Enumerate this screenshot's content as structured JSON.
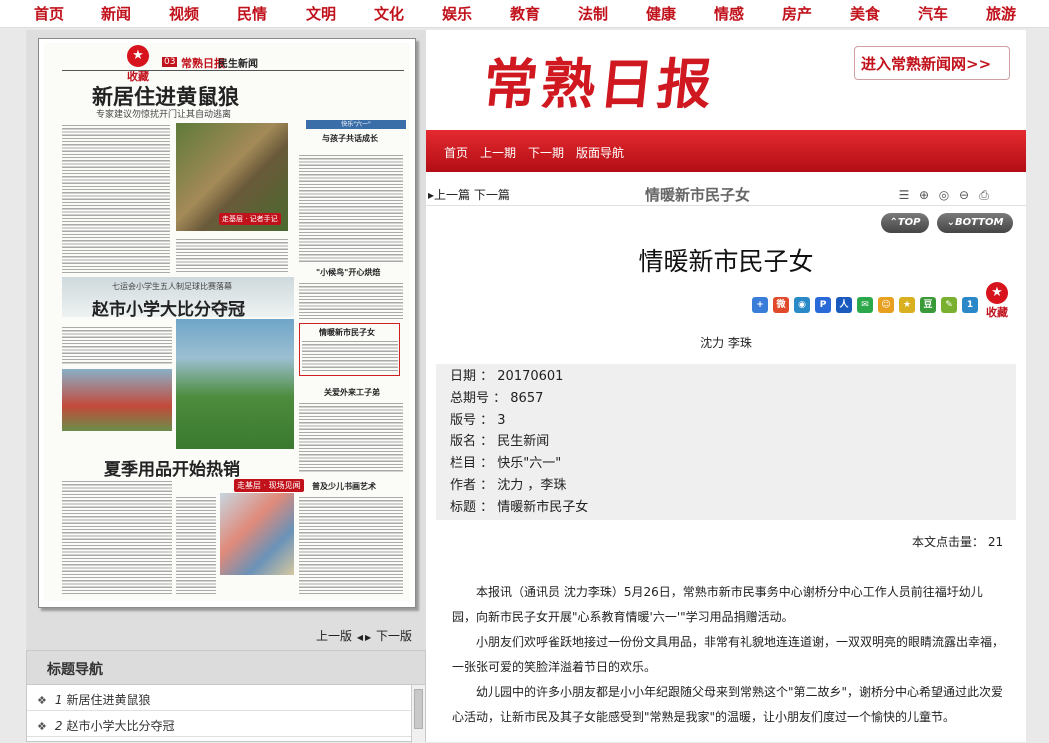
{
  "topnav": [
    "首页",
    "新闻",
    "视频",
    "民情",
    "文明",
    "文化",
    "娱乐",
    "教育",
    "法制",
    "健康",
    "情感",
    "房产",
    "美食",
    "汽车",
    "旅游"
  ],
  "paper": {
    "fav_label": "收藏",
    "page_no": "03",
    "brand": "常熟日报",
    "section": "民生新闻",
    "headline1": "新居住进黄鼠狼",
    "sub1": "专家建议勿惊扰开门让其自动逃离",
    "badge1": "走基层 · 记者手记",
    "column_tag": "快乐\"六一\"",
    "side_head1": "与孩子共话成长",
    "headline2": "赵市小学大比分夺冠",
    "sub2": "七运会小学生五人制足球比赛落幕",
    "side_head2": "\"小候鸟\"开心烘焙",
    "side_head3": "情暖新市民子女",
    "side_head4": "关爱外来工子弟",
    "headline3": "夏季用品开始热销",
    "badge2": "走基层 · 现场见闻",
    "side_head5": "普及少儿书画艺术"
  },
  "pager": {
    "prev": "上一版",
    "next": "下一版"
  },
  "title_nav": {
    "heading": "标题导航",
    "items": [
      {
        "num": "1",
        "label": "新居住进黄鼠狼"
      },
      {
        "num": "2",
        "label": "赵市小学大比分夺冠"
      }
    ]
  },
  "header": {
    "logo": "常熟日报",
    "goto": "进入常熟新闻网>>"
  },
  "redbar": [
    "首页",
    "上一期",
    "下一期",
    "版面导航"
  ],
  "subbar": {
    "prev": "上一篇",
    "next": "下一篇",
    "crumb": "情暖新市民子女"
  },
  "topbtns": {
    "top": "TOP",
    "bottom": "BOTTOM"
  },
  "article": {
    "title": "情暖新市民子女",
    "author": "沈力 李珠",
    "fav_label": "收藏",
    "meta": [
      {
        "k": "日期",
        "v": "20170601"
      },
      {
        "k": "总期号",
        "v": "8657"
      },
      {
        "k": "版号",
        "v": "3"
      },
      {
        "k": "版名",
        "v": "民生新闻"
      },
      {
        "k": "栏目",
        "v": "快乐\"六一\""
      },
      {
        "k": "作者",
        "v": "沈力 ，李珠"
      },
      {
        "k": "标题",
        "v": "情暖新市民子女"
      }
    ],
    "hits_label": "本文点击量：",
    "hits": "21",
    "paragraphs": [
      "本报讯（通讯员 沈力李珠）5月26日，常熟市新市民事务中心谢桥分中心工作人员前往福圩幼儿园，向新市民子女开展\"心系教育情暖'六一'\"学习用品捐赠活动。",
      "小朋友们欢呼雀跃地接过一份份文具用品，非常有礼貌地连连道谢，一双双明亮的眼睛流露出幸福，一张张可爱的笑脸洋溢着节日的欢乐。",
      "幼儿园中的许多小朋友都是小小年纪跟随父母来到常熟这个\"第二故乡\"，谢桥分中心希望通过此次爱心活动，让新市民及其子女能感受到\"常熟是我家\"的温暖，让小朋友们度过一个愉快的儿童节。"
    ]
  },
  "colors": {
    "brand_red": "#c1121c",
    "bar_red": "#d01a22"
  },
  "icons": [
    "star-icon",
    "print-icon",
    "zoom-in-icon",
    "zoom-out-icon",
    "reset-zoom-icon",
    "doc-icon"
  ]
}
